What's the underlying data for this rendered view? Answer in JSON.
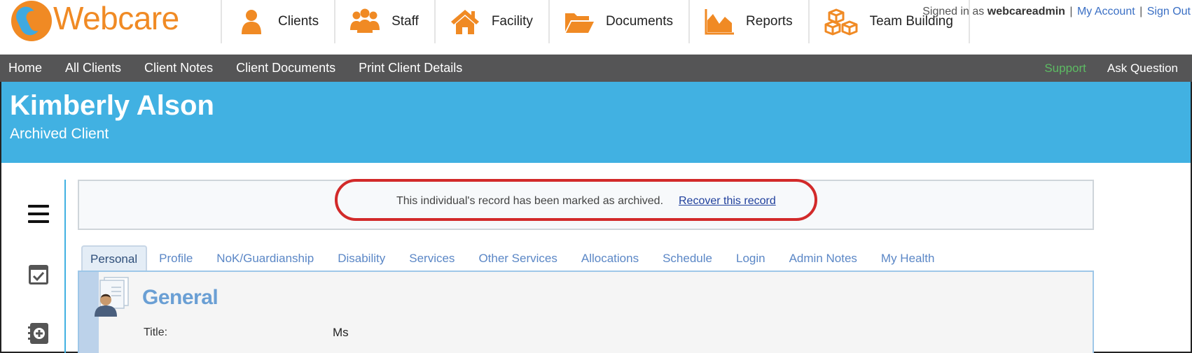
{
  "app": {
    "logo_text": "Webcare",
    "brand_orange": "#f08a24",
    "brand_blue": "#41b1e2"
  },
  "main_nav": [
    {
      "label": "Clients",
      "icon": "person-icon"
    },
    {
      "label": "Staff",
      "icon": "group-icon"
    },
    {
      "label": "Facility",
      "icon": "house-icon"
    },
    {
      "label": "Documents",
      "icon": "folder-icon"
    },
    {
      "label": "Reports",
      "icon": "area-chart-icon"
    },
    {
      "label": "Team Building",
      "icon": "boxes-icon"
    }
  ],
  "account": {
    "signed_in_prefix": "Signed in as",
    "username": "webcareadmin",
    "my_account": "My Account",
    "sign_out": "Sign Out"
  },
  "sub_nav": {
    "items": [
      "Home",
      "All Clients",
      "Client Notes",
      "Client Documents",
      "Print Client Details"
    ],
    "support": "Support",
    "ask_question": "Ask Question"
  },
  "client": {
    "name": "Kimberly Alson",
    "status": "Archived Client"
  },
  "notice": {
    "text": "This individual's record has been marked as archived.",
    "link": "Recover this record"
  },
  "tabs": [
    "Personal",
    "Profile",
    "NoK/Guardianship",
    "Disability",
    "Services",
    "Other Services",
    "Allocations",
    "Schedule",
    "Login",
    "Admin Notes",
    "My Health"
  ],
  "active_tab": "Personal",
  "section": {
    "title": "General",
    "fields": [
      {
        "label": "Title:",
        "value": "Ms"
      }
    ]
  }
}
